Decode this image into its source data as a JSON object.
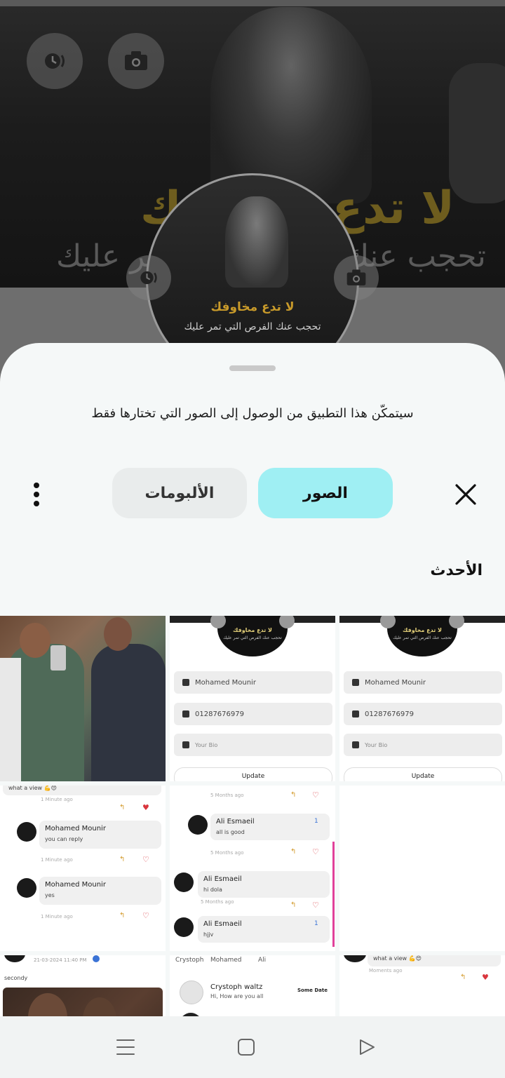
{
  "background": {
    "cover_title": "لا تدع مخاوفك",
    "cover_subtitle": "تحجب عنك الفرص التي تمر عليك",
    "avatar_title": "لا تدع مخاوفك",
    "avatar_subtitle": "تحجب عنك الفرص التي تمر عليك"
  },
  "sheet": {
    "notice": "سيتمكّن هذا التطبيق من الوصول إلى الصور التي تختارها فقط",
    "tabs": [
      {
        "label": "الصور",
        "selected": true
      },
      {
        "label": "الألبومات",
        "selected": false
      }
    ],
    "section_title": "الأحدث",
    "close_icon": "close-icon",
    "more_icon": "more-vert-icon"
  },
  "grid": {
    "profile_tile": {
      "name": "Mohamed Mounir",
      "phone": "01287676979",
      "bio_placeholder": "Your Bio",
      "update_label": "Update",
      "avatar_title": "لا تدع مخاوفك",
      "avatar_subtitle": "تحجب عنك الفرص التي تمر عليك"
    },
    "comments_tile_a": {
      "top_text": "what a view 💪😍",
      "top_time": "1 Minute ago",
      "c1_name": "Mohamed Mounir",
      "c1_text": "you can reply",
      "c1_time": "1 Minute ago",
      "c2_name": "Mohamed Mounir",
      "c2_text": "yes",
      "c2_time": "1 Minute ago"
    },
    "comments_tile_b": {
      "t0": "5 Months ago",
      "c1_name": "Ali Esmaeil",
      "c1_text": "all is good",
      "c1_likes": "1",
      "t1": "5 Months ago",
      "c2_name": "Ali Esmaeil",
      "c2_text": "hi dola",
      "t2": "5 Months ago",
      "c3_name": "Ali Esmaeil",
      "c3_text": "hjjv",
      "c3_likes": "1"
    },
    "post_tile": {
      "date": "21-03-2024 11:40 PM",
      "text": "secondy"
    },
    "chat_tile": {
      "tabs": [
        "Crystoph",
        "Mohamed",
        "Ali"
      ],
      "name": "Crystoph waltz",
      "message": "Hi, How are you all",
      "date": "Some Date"
    },
    "view_tile": {
      "text": "what a view 💪😍",
      "time": "Moments ago"
    }
  },
  "navbar": {
    "icons": [
      "menu-icon",
      "home-square-icon",
      "back-triangle-icon"
    ]
  }
}
